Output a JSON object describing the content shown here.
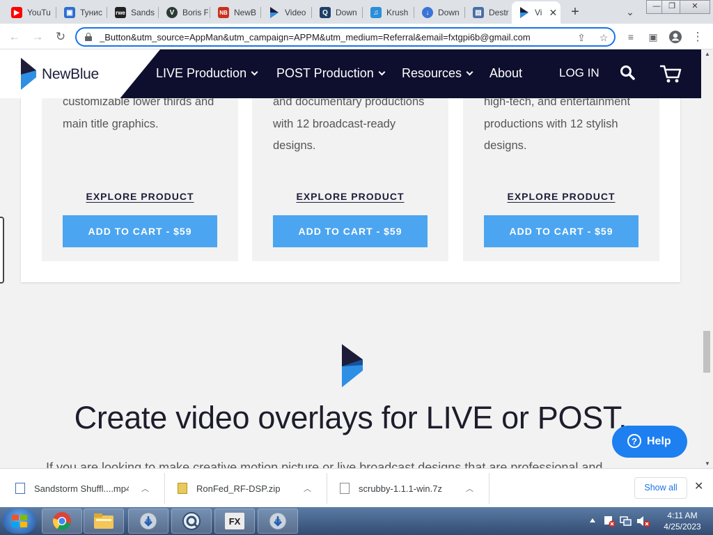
{
  "browser": {
    "tabs": [
      {
        "label": "YouTu",
        "favicon": "youtube-icon",
        "color": "#ff0000"
      },
      {
        "label": "Тунис",
        "favicon": "page-icon",
        "color": "#2f6fd1"
      },
      {
        "label": "Sands",
        "favicon": "rwe-icon",
        "color": "#222222"
      },
      {
        "label": "Boris F",
        "favicon": "v-icon",
        "color": "#2a3a35"
      },
      {
        "label": "NewB",
        "favicon": "nb-icon",
        "color": "#c8321f"
      },
      {
        "label": "Video",
        "favicon": "newblue-icon",
        "color": "#1d1d3a"
      },
      {
        "label": "Down",
        "favicon": "q-icon",
        "color": "#1d3f67"
      },
      {
        "label": "Krush",
        "favicon": "music-icon",
        "color": "#2a8fd8"
      },
      {
        "label": "Down",
        "favicon": "pin-icon",
        "color": "#3b73d6"
      },
      {
        "label": "Destr",
        "favicon": "doc-icon",
        "color": "#4a6fa5"
      },
      {
        "label": "Vi",
        "favicon": "newblue-icon",
        "color": "#1d1d3a",
        "active": true
      }
    ],
    "url": "_Button&utm_source=AppMan&utm_campaign=APPM&utm_medium=Referral&email=fxtgpi6b@gmail.com"
  },
  "site": {
    "logo": "NewBlue",
    "nav": [
      {
        "label": "LIVE Production",
        "dropdown": true
      },
      {
        "label": "POST Production",
        "dropdown": true
      },
      {
        "label": "Resources",
        "dropdown": true
      },
      {
        "label": "About",
        "dropdown": false
      }
    ],
    "login": "LOG IN"
  },
  "cards": [
    {
      "desc": "customizable lower thirds and main title graphics.",
      "explore": "EXPLORE PRODUCT",
      "cart": "ADD TO CART - $59"
    },
    {
      "desc": "and documentary productions with 12 broadcast-ready designs.",
      "explore": "EXPLORE PRODUCT",
      "cart": "ADD TO CART - $59"
    },
    {
      "desc": "high-tech, and entertainment productions with 12 stylish designs.",
      "explore": "EXPLORE PRODUCT",
      "cart": "ADD TO CART - $59"
    }
  ],
  "section": {
    "headline": "Create video overlays for LIVE or POST.",
    "body_cut": "If you are looking to make creative motion picture or live broadcast designs that are professional and"
  },
  "help": {
    "label": "Help"
  },
  "downloads": {
    "items": [
      {
        "name": "Sandstorm Shuffl....mp4",
        "icon": "video-file-icon"
      },
      {
        "name": "RonFed_RF-DSP.zip",
        "icon": "zip-file-icon"
      },
      {
        "name": "scrubby-1.1.1-win.7z",
        "icon": "file-icon"
      }
    ],
    "show_all": "Show all"
  },
  "taskbar": {
    "time": "4:11 AM",
    "date": "4/25/2023"
  }
}
